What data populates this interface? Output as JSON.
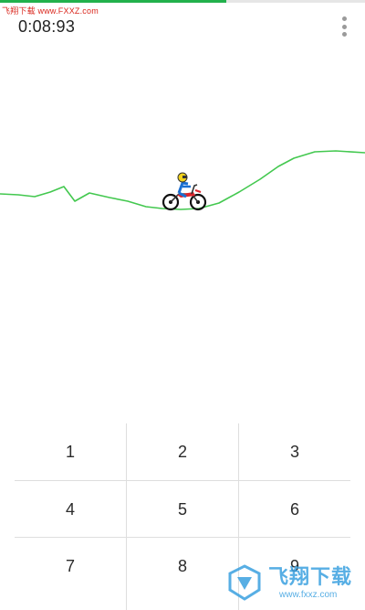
{
  "header": {
    "site_mark": "飞翔下载 www.FXXZ.com",
    "timer": "0:08:93",
    "progress_fraction": 0.62,
    "progress_color": "#22b14c"
  },
  "track": {
    "line_color": "#43c84f",
    "rider_icon": "motorbike-rider-icon"
  },
  "keypad": {
    "keys": [
      "1",
      "2",
      "3",
      "4",
      "5",
      "6",
      "7",
      "8",
      "9"
    ]
  },
  "watermark": {
    "text": "飞翔下载",
    "url": "www.fxxz.com",
    "logo_icon": "fxxz-logo-icon"
  },
  "menu": {
    "icon": "more-vert-icon"
  }
}
